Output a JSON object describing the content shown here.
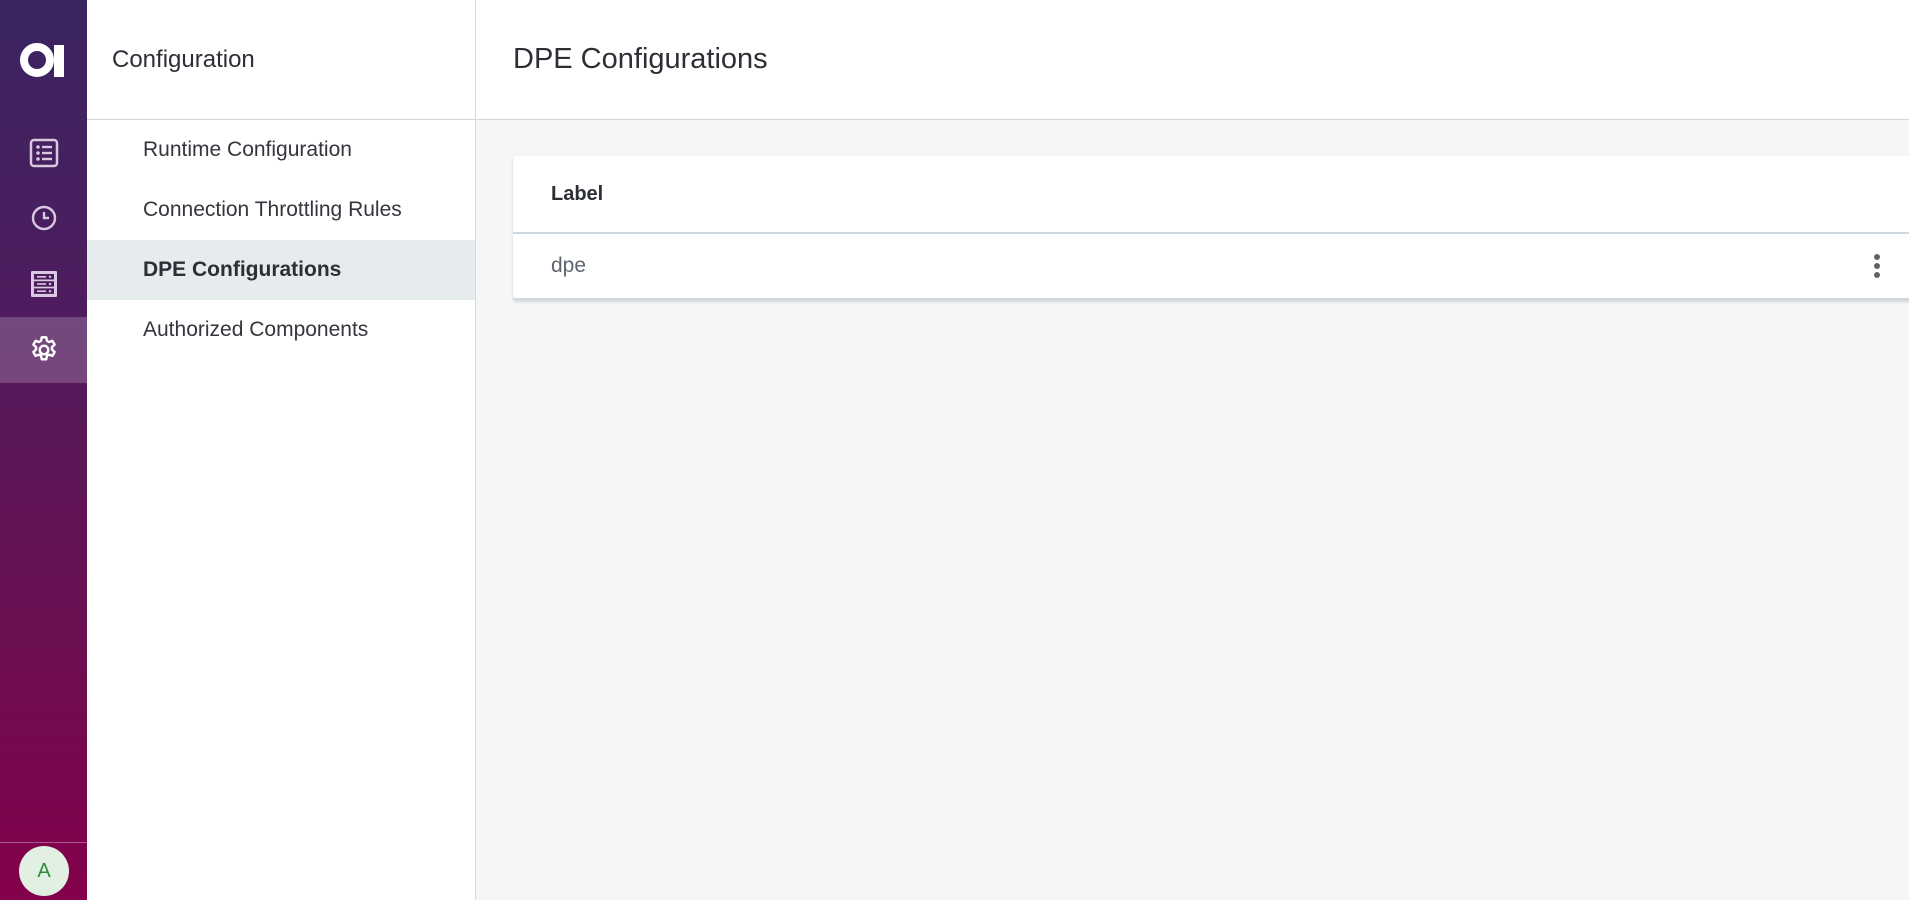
{
  "rail": {
    "logo": "a-logo-icon",
    "items": [
      {
        "id": "list",
        "icon": "list-icon",
        "active": false
      },
      {
        "id": "history",
        "icon": "clock-icon",
        "active": false
      },
      {
        "id": "servers",
        "icon": "server-icon",
        "active": false
      },
      {
        "id": "configuration",
        "icon": "gear-icon",
        "active": true
      }
    ],
    "avatar_initial": "A",
    "colors": {
      "gradient_top": "#3a2560",
      "gradient_bottom": "#83004a",
      "icon": "#d8c9e0",
      "avatar_bg": "#e2f0e4",
      "avatar_text": "#2e8b3a"
    }
  },
  "panel": {
    "title": "Configuration",
    "items": [
      {
        "label": "Runtime Configuration",
        "active": false
      },
      {
        "label": "Connection Throttling Rules",
        "active": false
      },
      {
        "label": "DPE Configurations",
        "active": true
      },
      {
        "label": "Authorized Components",
        "active": false
      }
    ]
  },
  "main": {
    "title": "DPE Configurations",
    "table": {
      "columns": [
        "Label"
      ],
      "rows": [
        {
          "label": "dpe",
          "actions_icon": "more-vertical-icon"
        }
      ]
    }
  }
}
